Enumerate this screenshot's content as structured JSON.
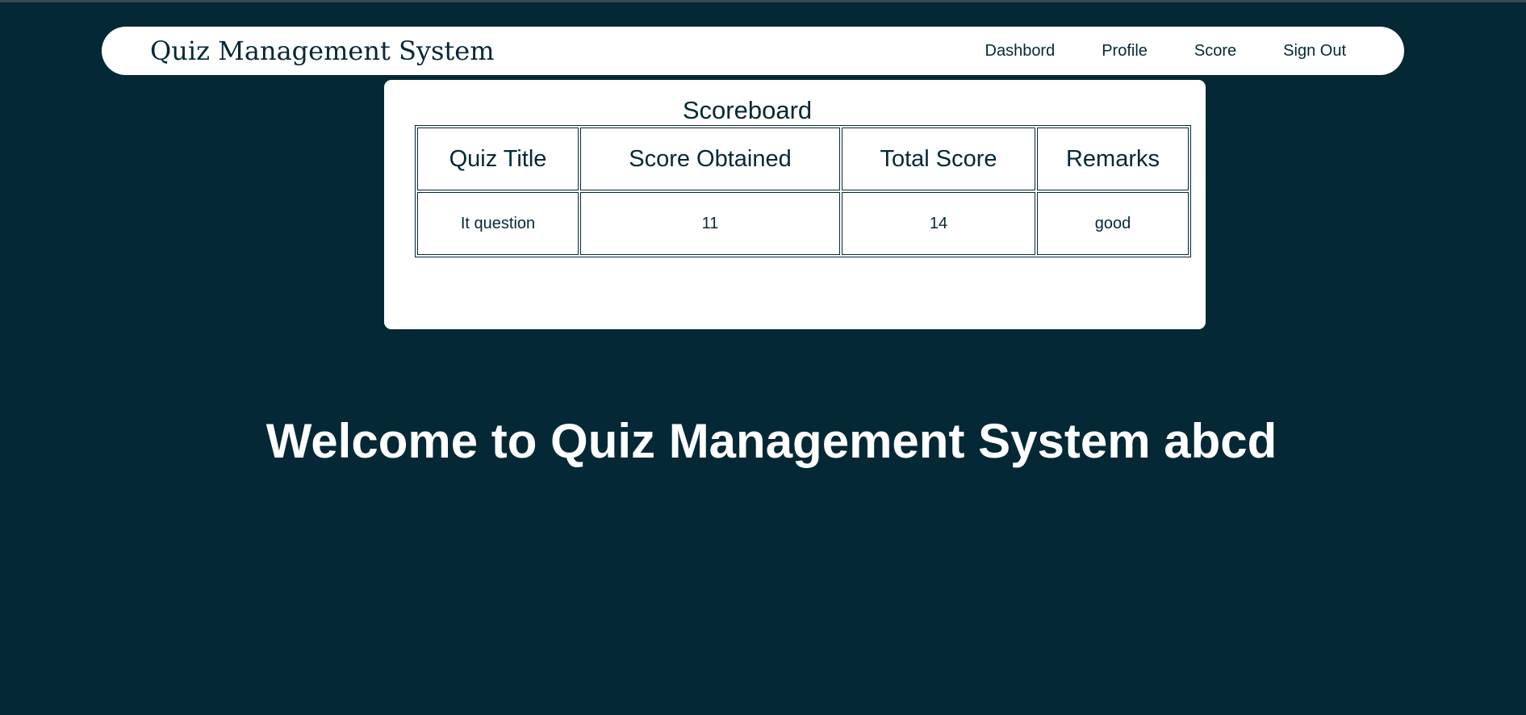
{
  "header": {
    "brand": "Quiz Management System",
    "nav": [
      {
        "label": "Dashbord"
      },
      {
        "label": "Profile"
      },
      {
        "label": "Score"
      },
      {
        "label": "Sign Out"
      }
    ]
  },
  "scoreboard": {
    "title": "Scoreboard",
    "columns": [
      "Quiz Title",
      "Score Obtained",
      "Total Score",
      "Remarks"
    ],
    "rows": [
      [
        "It question",
        "11",
        "14",
        "good"
      ]
    ]
  },
  "welcome": {
    "text": "Welcome to Quiz Management System abcd"
  },
  "colors": {
    "background": "#042836",
    "surface": "#ffffff",
    "text_dark": "#042836"
  }
}
